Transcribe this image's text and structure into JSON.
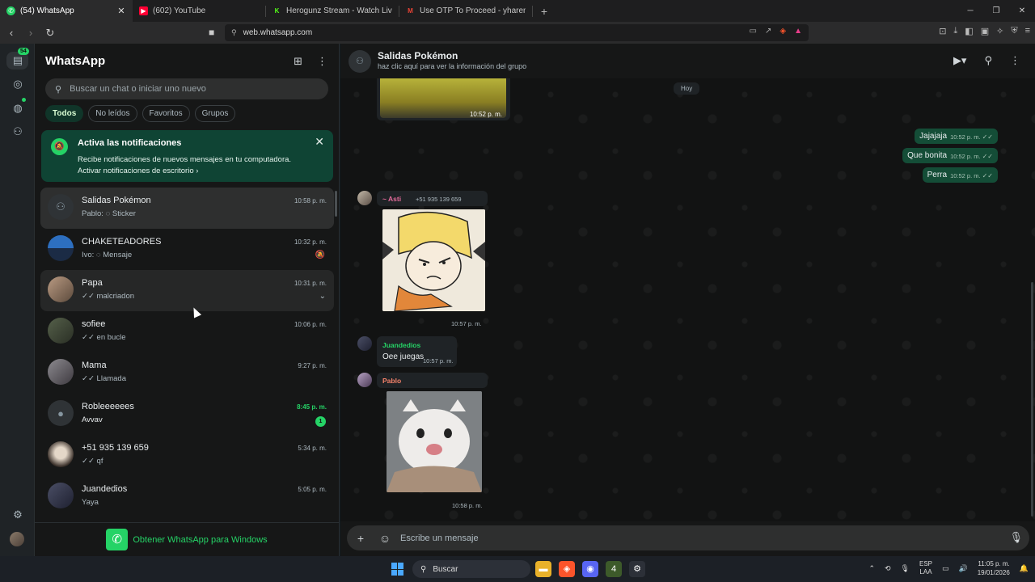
{
  "browser": {
    "tabs": [
      {
        "label": "(54) WhatsApp",
        "icon": "whatsapp-icon",
        "active": true
      },
      {
        "label": "(602) YouTube",
        "icon": "youtube-icon"
      },
      {
        "label": "Herogunz Stream - Watch Live on Ki",
        "icon": "kick-icon"
      },
      {
        "label": "Use OTP To Proceed - yharemf@gma",
        "icon": "gmail-icon"
      }
    ],
    "url": "web.whatsapp.com"
  },
  "rail": {
    "badge": "54"
  },
  "sidebar": {
    "title": "WhatsApp",
    "search_placeholder": "Buscar un chat o iniciar uno nuevo",
    "filters": [
      "Todos",
      "No leídos",
      "Favoritos",
      "Grupos"
    ],
    "notification": {
      "title": "Activa las notificaciones",
      "body": "Recibe notificaciones de nuevos mensajes en tu computadora.",
      "link": "Activar notificaciones de escritorio"
    },
    "chats": [
      {
        "name": "Salidas Pokémon",
        "preview": "Pablo: ◌ Sticker",
        "time": "10:58 p. m."
      },
      {
        "name": "CHAKETEADORES",
        "preview": "Ivo: ◌ Mensaje",
        "time": "10:32 p. m."
      },
      {
        "name": "Papa",
        "preview": "✓✓ malcriadon",
        "time": "10:31 p. m."
      },
      {
        "name": "sofiee",
        "preview": "✓✓ en bucle",
        "time": "10:06 p. m."
      },
      {
        "name": "Mama",
        "preview": "✓✓ Llamada",
        "time": "9:27 p. m."
      },
      {
        "name": "Robleeeeees",
        "preview": "Avvav",
        "time": "8:45 p. m.",
        "unread": "1"
      },
      {
        "name": "+51 935 139 659",
        "preview": "✓✓ qf",
        "time": "5:34 p. m."
      },
      {
        "name": "Juandedios",
        "preview": "Yaya",
        "time": "5:05 p. m."
      }
    ],
    "footer": "Obtener WhatsApp para Windows"
  },
  "conversation": {
    "title": "Salidas Pokémon",
    "subtitle": "haz clic aquí para ver la información del grupo",
    "day": "Hoy",
    "top_image_time": "10:52 p. m.",
    "outgoing": [
      {
        "text": "Jajajaja",
        "time": "10:52 p. m."
      },
      {
        "text": "Que bonita",
        "time": "10:52 p. m."
      },
      {
        "text": "Perra",
        "time": "10:52 p. m."
      }
    ],
    "sticker1": {
      "sender": "~ Asti",
      "phone": "+51 935 139 659",
      "time": "10:57 p. m."
    },
    "text_msg": {
      "sender": "Juandedios",
      "text": "Oee juegas",
      "time": "10:57 p. m."
    },
    "sticker2": {
      "sender": "Pablo",
      "time": "10:58 p. m."
    },
    "composer_placeholder": "Escribe un mensaje"
  },
  "taskbar": {
    "search": "Buscar",
    "lang1": "ESP",
    "lang2": "LAA",
    "time": "11:05 p. m.",
    "date": "19/01/2026"
  },
  "colors": {
    "accent": "#25d366",
    "outgoing_bubble": "#144d37",
    "notif_bg": "#0f4434"
  }
}
